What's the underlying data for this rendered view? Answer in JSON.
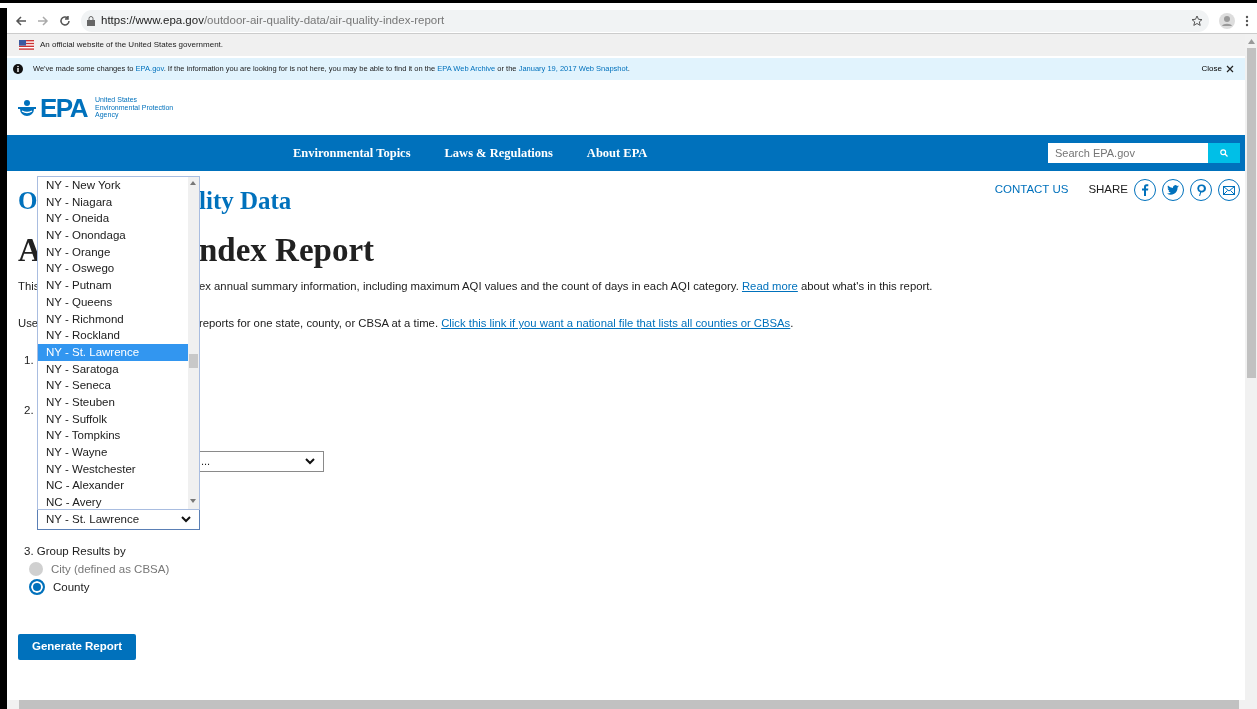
{
  "browser": {
    "url_host": "https://www.epa.gov",
    "url_path": "/outdoor-air-quality-data/air-quality-index-report"
  },
  "gov_banner": {
    "text": "An official website of the United States government."
  },
  "notice": {
    "segments": [
      {
        "kind": "text",
        "text": "We've made some changes to "
      },
      {
        "kind": "link",
        "text": "EPA.gov"
      },
      {
        "kind": "text",
        "text": ". If the information you are looking for is not here, you may be able to find it on the "
      },
      {
        "kind": "link",
        "text": "EPA Web Archive"
      },
      {
        "kind": "text",
        "text": " or the "
      },
      {
        "kind": "link",
        "text": "January 19, 2017 Web Snapshot"
      },
      {
        "kind": "text",
        "text": "."
      }
    ],
    "close": "Close"
  },
  "logo": {
    "mark": "EPA",
    "lines": [
      "United States",
      "Environmental Protection",
      "Agency"
    ]
  },
  "nav": {
    "items": [
      "Environmental Topics",
      "Laws & Regulations",
      "About EPA"
    ],
    "search_placeholder": "Search EPA.gov"
  },
  "utility": {
    "contact": "CONTACT US",
    "share": "SHARE"
  },
  "page_title_parts": [
    "O",
    "lity Data"
  ],
  "report_title_parts": [
    "A",
    "ndex Report"
  ],
  "intro": {
    "left": "This",
    "segments": [
      {
        "kind": "text",
        "text": "ex annual summary information, including maximum AQI values and the count of days in each AQI category. "
      },
      {
        "kind": "link",
        "text": "Read more"
      },
      {
        "kind": "text",
        "text": " about what's in this report."
      }
    ]
  },
  "usage": {
    "left": "Use",
    "segments": [
      {
        "kind": "text",
        "text": "reports for one state, county, or CBSA at a time. "
      },
      {
        "kind": "link",
        "text": "Click this link if you want a national file that lists all counties or CBSAs"
      },
      {
        "kind": "text",
        "text": "."
      }
    ]
  },
  "steps": [
    {
      "number": "1."
    },
    {
      "number": "2."
    }
  ],
  "area_select": {
    "value_tail": "..."
  },
  "county_select": {
    "value": "NY - St. Lawrence",
    "expanded": true,
    "options": [
      {
        "label": "NY - New York",
        "selected": false
      },
      {
        "label": "NY - Niagara",
        "selected": false
      },
      {
        "label": "NY - Oneida",
        "selected": false
      },
      {
        "label": "NY - Onondaga",
        "selected": false
      },
      {
        "label": "NY - Orange",
        "selected": false
      },
      {
        "label": "NY - Oswego",
        "selected": false
      },
      {
        "label": "NY - Putnam",
        "selected": false
      },
      {
        "label": "NY - Queens",
        "selected": false
      },
      {
        "label": "NY - Richmond",
        "selected": false
      },
      {
        "label": "NY - Rockland",
        "selected": false
      },
      {
        "label": "NY - St. Lawrence",
        "selected": true
      },
      {
        "label": "NY - Saratoga",
        "selected": false
      },
      {
        "label": "NY - Seneca",
        "selected": false
      },
      {
        "label": "NY - Steuben",
        "selected": false
      },
      {
        "label": "NY - Suffolk",
        "selected": false
      },
      {
        "label": "NY - Tompkins",
        "selected": false
      },
      {
        "label": "NY - Wayne",
        "selected": false
      },
      {
        "label": "NY - Westchester",
        "selected": false
      },
      {
        "label": "NC - Alexander",
        "selected": false
      },
      {
        "label": "NC - Avery",
        "selected": false
      }
    ]
  },
  "group_by": {
    "label": "3. Group Results by",
    "options": [
      {
        "label": "City (defined as CBSA)",
        "selected": false,
        "disabled": true
      },
      {
        "label": "County",
        "selected": true,
        "disabled": false
      }
    ]
  },
  "generate_button": "Generate Report"
}
